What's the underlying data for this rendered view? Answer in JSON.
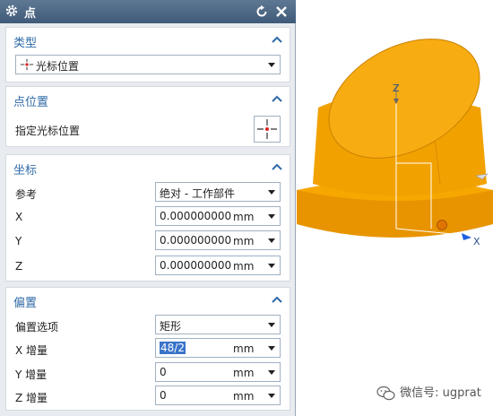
{
  "window": {
    "title": "点"
  },
  "type_section": {
    "title": "类型",
    "selected": "光标位置"
  },
  "point_section": {
    "title": "点位置",
    "label": "指定光标位置"
  },
  "coords_section": {
    "title": "坐标",
    "ref_label": "参考",
    "ref_value": "绝对 - 工作部件",
    "x_label": "X",
    "x_value": "0.0000000000",
    "y_label": "Y",
    "y_value": "0.0000000000",
    "z_label": "Z",
    "z_value": "0.0000000000",
    "unit": "mm"
  },
  "offset_section": {
    "title": "偏置",
    "option_label": "偏置选项",
    "option_value": "矩形",
    "x_label": "X 增量",
    "x_value": "48/2",
    "y_label": "Y 增量",
    "y_value": "0",
    "z_label": "Z 增量",
    "z_value": "0",
    "unit": "mm"
  },
  "viewport": {
    "axis_z": "Z",
    "axis_x": "X",
    "part_color": "#f7a800"
  },
  "watermark": {
    "text": "微信号: ugprat"
  }
}
